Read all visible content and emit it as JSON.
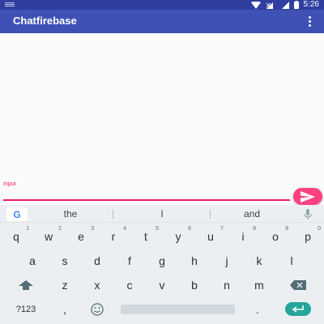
{
  "status_bar": {
    "time": "5:26",
    "left_icon": "notification-icon",
    "icons": [
      "wifi-icon",
      "signal-icon",
      "battery-icon"
    ],
    "color": "#303F9F"
  },
  "app_bar": {
    "title": "Chatfirebase",
    "menu_icon": "overflow-menu-icon",
    "color": "#3F51B5"
  },
  "composer": {
    "input_label": "Input",
    "input_value": "",
    "accent_color": "#e91e63",
    "send_icon": "send-icon",
    "fab_color": "#FF4081"
  },
  "keyboard": {
    "suggestions": [
      "the",
      "I",
      "and"
    ],
    "row1": [
      {
        "key": "q",
        "hint": "1"
      },
      {
        "key": "w",
        "hint": "2"
      },
      {
        "key": "e",
        "hint": "3"
      },
      {
        "key": "r",
        "hint": "4"
      },
      {
        "key": "t",
        "hint": "5"
      },
      {
        "key": "y",
        "hint": "6"
      },
      {
        "key": "u",
        "hint": "7"
      },
      {
        "key": "i",
        "hint": "8"
      },
      {
        "key": "o",
        "hint": "9"
      },
      {
        "key": "p",
        "hint": "0"
      }
    ],
    "row2": [
      "a",
      "s",
      "d",
      "f",
      "g",
      "h",
      "j",
      "k",
      "l"
    ],
    "row3": [
      "z",
      "x",
      "c",
      "v",
      "b",
      "n",
      "m"
    ],
    "symbols_label": "?123",
    "comma_label": ",",
    "period_label": ".",
    "enter_color": "#26a69a"
  }
}
